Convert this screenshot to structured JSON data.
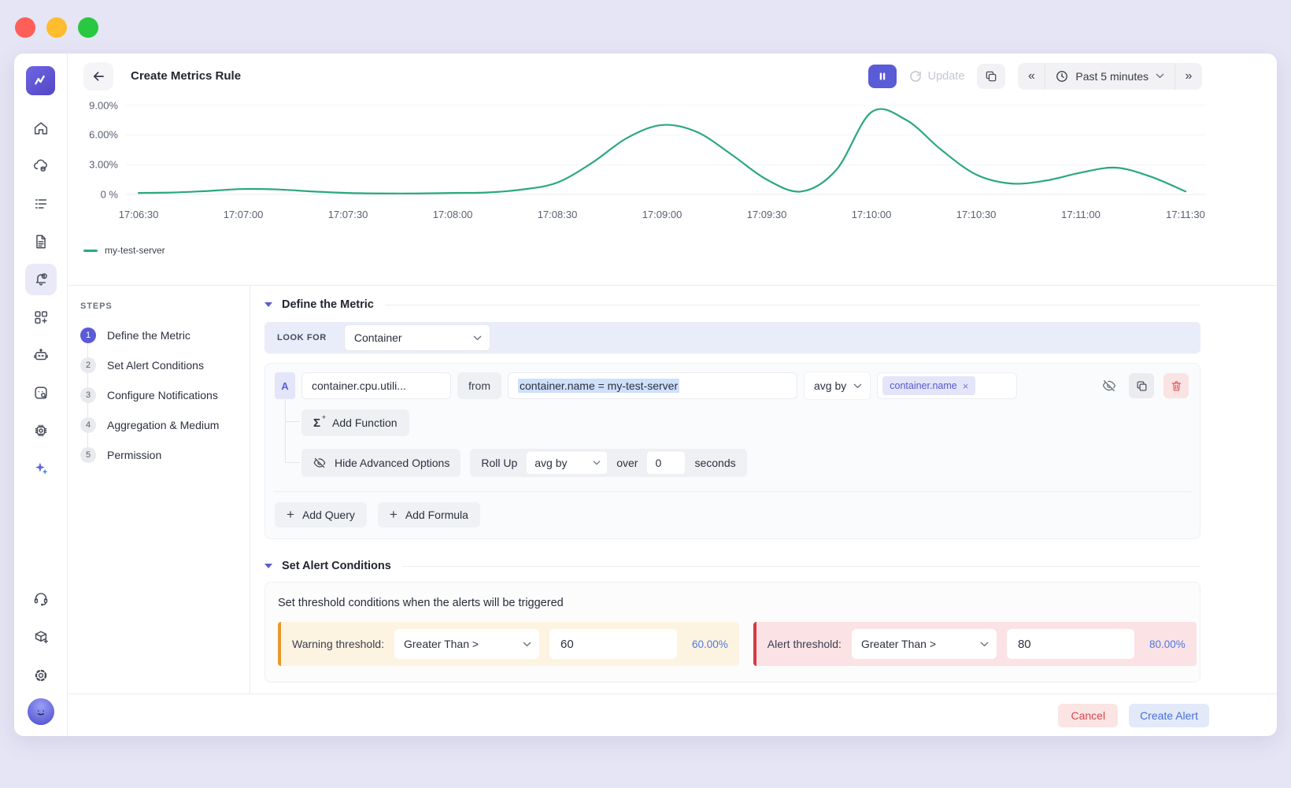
{
  "window": {
    "traffic_lights": [
      "close",
      "minimize",
      "zoom"
    ]
  },
  "sidebar": {
    "active_index": 4,
    "items": [
      "home",
      "infrastructure",
      "logs",
      "documents",
      "alerts",
      "dashboards",
      "bot",
      "synthetics",
      "processes",
      "ai-assistant",
      "support",
      "installation",
      "settings",
      "user"
    ]
  },
  "header": {
    "title": "Create Metrics Rule",
    "update_label": "Update",
    "time_range_label": "Past 5 minutes"
  },
  "chart_data": {
    "type": "line",
    "title": "",
    "xlabel": "",
    "ylabel": "",
    "grid": "horizontal",
    "legend_position": "bottom-left",
    "ylim": [
      0,
      9.9
    ],
    "unit": "%",
    "y_ticks": [
      {
        "label": "9.00%",
        "value": 9
      },
      {
        "label": "6.00%",
        "value": 6
      },
      {
        "label": "3.00%",
        "value": 3
      },
      {
        "label": "0 %",
        "value": 0
      }
    ],
    "x_tick_labels": [
      "17:06:30",
      "17:07:00",
      "17:07:30",
      "17:08:00",
      "17:08:30",
      "17:09:00",
      "17:09:30",
      "17:10:00",
      "17:10:30",
      "17:11:00",
      "17:11:30"
    ],
    "x_tick_seconds": [
      0,
      30,
      60,
      90,
      120,
      150,
      180,
      210,
      240,
      270,
      300
    ],
    "series": [
      {
        "name": "my-test-server",
        "color": "#2aa87e",
        "x_seconds": [
          0,
          10,
          20,
          30,
          40,
          50,
          60,
          70,
          80,
          90,
          100,
          110,
          120,
          130,
          140,
          150,
          160,
          170,
          180,
          190,
          200,
          210,
          220,
          230,
          240,
          250,
          260,
          270,
          280,
          290,
          300
        ],
        "values": [
          0.15,
          0.2,
          0.35,
          0.55,
          0.5,
          0.3,
          0.15,
          0.1,
          0.1,
          0.15,
          0.2,
          0.5,
          1.2,
          3.2,
          5.7,
          7.0,
          6.3,
          4.0,
          1.5,
          0.3,
          2.5,
          8.3,
          7.5,
          4.5,
          2.0,
          1.1,
          1.4,
          2.2,
          2.7,
          1.8,
          0.3
        ]
      }
    ]
  },
  "steps": {
    "heading": "STEPS",
    "items": [
      {
        "num": "1",
        "label": "Define the Metric",
        "active": true
      },
      {
        "num": "2",
        "label": "Set Alert Conditions",
        "active": false
      },
      {
        "num": "3",
        "label": "Configure Notifications",
        "active": false
      },
      {
        "num": "4",
        "label": "Aggregation & Medium",
        "active": false
      },
      {
        "num": "5",
        "label": "Permission",
        "active": false
      }
    ]
  },
  "define_metric": {
    "section_title": "Define the Metric",
    "look_for_label": "LOOK FOR",
    "look_for_value": "Container",
    "query": {
      "letter": "A",
      "metric_value": "container.cpu.utili...",
      "from_label": "from",
      "filter_value": "container.name = my-test-server",
      "agg_value": "avg by",
      "group_tag": "container.name",
      "add_function_label": "Add Function",
      "hide_advanced_label": "Hide Advanced Options",
      "rollup_label": "Roll Up",
      "rollup_agg_value": "avg by",
      "over_label": "over",
      "rollup_window_value": "0",
      "seconds_label": "seconds"
    },
    "add_query_label": "Add Query",
    "add_formula_label": "Add Formula"
  },
  "alert_conditions": {
    "section_title": "Set Alert Conditions",
    "description": "Set threshold conditions when the alerts will be triggered",
    "warning": {
      "label": "Warning threshold:",
      "operator": "Greater Than >",
      "value": "60",
      "percent": "60.00%"
    },
    "alert": {
      "label": "Alert threshold:",
      "operator": "Greater Than >",
      "value": "80",
      "percent": "80.00%"
    }
  },
  "footer": {
    "cancel_label": "Cancel",
    "create_label": "Create Alert"
  },
  "colors": {
    "accent": "#5a5bd6",
    "series_green": "#2aa87e",
    "warning_border": "#e9992b",
    "alert_border": "#d63a44",
    "percent_blue": "#4b79dd",
    "traffic": [
      "#ff5f57",
      "#febc2e",
      "#28c840"
    ]
  }
}
